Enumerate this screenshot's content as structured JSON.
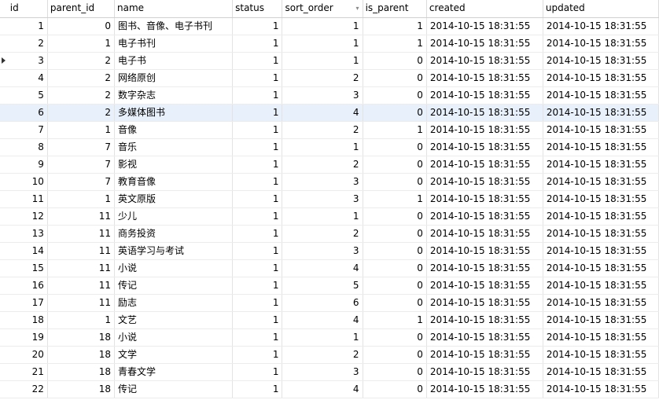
{
  "columns": [
    "id",
    "parent_id",
    "name",
    "status",
    "sort_order",
    "is_parent",
    "created",
    "updated"
  ],
  "rows": [
    {
      "id": "1",
      "parent_id": "0",
      "name": "图书、音像、电子书刊",
      "status": "1",
      "sort_order": "1",
      "is_parent": "1",
      "created": "2014-10-15 18:31:55",
      "updated": "2014-10-15 18:31:55"
    },
    {
      "id": "2",
      "parent_id": "1",
      "name": "电子书刊",
      "status": "1",
      "sort_order": "1",
      "is_parent": "1",
      "created": "2014-10-15 18:31:55",
      "updated": "2014-10-15 18:31:55"
    },
    {
      "id": "3",
      "parent_id": "2",
      "name": "电子书",
      "status": "1",
      "sort_order": "1",
      "is_parent": "0",
      "created": "2014-10-15 18:31:55",
      "updated": "2014-10-15 18:31:55"
    },
    {
      "id": "4",
      "parent_id": "2",
      "name": "网络原创",
      "status": "1",
      "sort_order": "2",
      "is_parent": "0",
      "created": "2014-10-15 18:31:55",
      "updated": "2014-10-15 18:31:55"
    },
    {
      "id": "5",
      "parent_id": "2",
      "name": "数字杂志",
      "status": "1",
      "sort_order": "3",
      "is_parent": "0",
      "created": "2014-10-15 18:31:55",
      "updated": "2014-10-15 18:31:55"
    },
    {
      "id": "6",
      "parent_id": "2",
      "name": "多媒体图书",
      "status": "1",
      "sort_order": "4",
      "is_parent": "0",
      "created": "2014-10-15 18:31:55",
      "updated": "2014-10-15 18:31:55"
    },
    {
      "id": "7",
      "parent_id": "1",
      "name": "音像",
      "status": "1",
      "sort_order": "2",
      "is_parent": "1",
      "created": "2014-10-15 18:31:55",
      "updated": "2014-10-15 18:31:55"
    },
    {
      "id": "8",
      "parent_id": "7",
      "name": "音乐",
      "status": "1",
      "sort_order": "1",
      "is_parent": "0",
      "created": "2014-10-15 18:31:55",
      "updated": "2014-10-15 18:31:55"
    },
    {
      "id": "9",
      "parent_id": "7",
      "name": "影视",
      "status": "1",
      "sort_order": "2",
      "is_parent": "0",
      "created": "2014-10-15 18:31:55",
      "updated": "2014-10-15 18:31:55"
    },
    {
      "id": "10",
      "parent_id": "7",
      "name": "教育音像",
      "status": "1",
      "sort_order": "3",
      "is_parent": "0",
      "created": "2014-10-15 18:31:55",
      "updated": "2014-10-15 18:31:55"
    },
    {
      "id": "11",
      "parent_id": "1",
      "name": "英文原版",
      "status": "1",
      "sort_order": "3",
      "is_parent": "1",
      "created": "2014-10-15 18:31:55",
      "updated": "2014-10-15 18:31:55"
    },
    {
      "id": "12",
      "parent_id": "11",
      "name": "少儿",
      "status": "1",
      "sort_order": "1",
      "is_parent": "0",
      "created": "2014-10-15 18:31:55",
      "updated": "2014-10-15 18:31:55"
    },
    {
      "id": "13",
      "parent_id": "11",
      "name": "商务投资",
      "status": "1",
      "sort_order": "2",
      "is_parent": "0",
      "created": "2014-10-15 18:31:55",
      "updated": "2014-10-15 18:31:55"
    },
    {
      "id": "14",
      "parent_id": "11",
      "name": "英语学习与考试",
      "status": "1",
      "sort_order": "3",
      "is_parent": "0",
      "created": "2014-10-15 18:31:55",
      "updated": "2014-10-15 18:31:55"
    },
    {
      "id": "15",
      "parent_id": "11",
      "name": "小说",
      "status": "1",
      "sort_order": "4",
      "is_parent": "0",
      "created": "2014-10-15 18:31:55",
      "updated": "2014-10-15 18:31:55"
    },
    {
      "id": "16",
      "parent_id": "11",
      "name": "传记",
      "status": "1",
      "sort_order": "5",
      "is_parent": "0",
      "created": "2014-10-15 18:31:55",
      "updated": "2014-10-15 18:31:55"
    },
    {
      "id": "17",
      "parent_id": "11",
      "name": "励志",
      "status": "1",
      "sort_order": "6",
      "is_parent": "0",
      "created": "2014-10-15 18:31:55",
      "updated": "2014-10-15 18:31:55"
    },
    {
      "id": "18",
      "parent_id": "1",
      "name": "文艺",
      "status": "1",
      "sort_order": "4",
      "is_parent": "1",
      "created": "2014-10-15 18:31:55",
      "updated": "2014-10-15 18:31:55"
    },
    {
      "id": "19",
      "parent_id": "18",
      "name": "小说",
      "status": "1",
      "sort_order": "1",
      "is_parent": "0",
      "created": "2014-10-15 18:31:55",
      "updated": "2014-10-15 18:31:55"
    },
    {
      "id": "20",
      "parent_id": "18",
      "name": "文学",
      "status": "1",
      "sort_order": "2",
      "is_parent": "0",
      "created": "2014-10-15 18:31:55",
      "updated": "2014-10-15 18:31:55"
    },
    {
      "id": "21",
      "parent_id": "18",
      "name": "青春文学",
      "status": "1",
      "sort_order": "3",
      "is_parent": "0",
      "created": "2014-10-15 18:31:55",
      "updated": "2014-10-15 18:31:55"
    },
    {
      "id": "22",
      "parent_id": "18",
      "name": "传记",
      "status": "1",
      "sort_order": "4",
      "is_parent": "0",
      "created": "2014-10-15 18:31:55",
      "updated": "2014-10-15 18:31:55"
    }
  ],
  "current_row_index": 2,
  "selected_row_index": 5,
  "sort_indicator_column": "sort_order"
}
